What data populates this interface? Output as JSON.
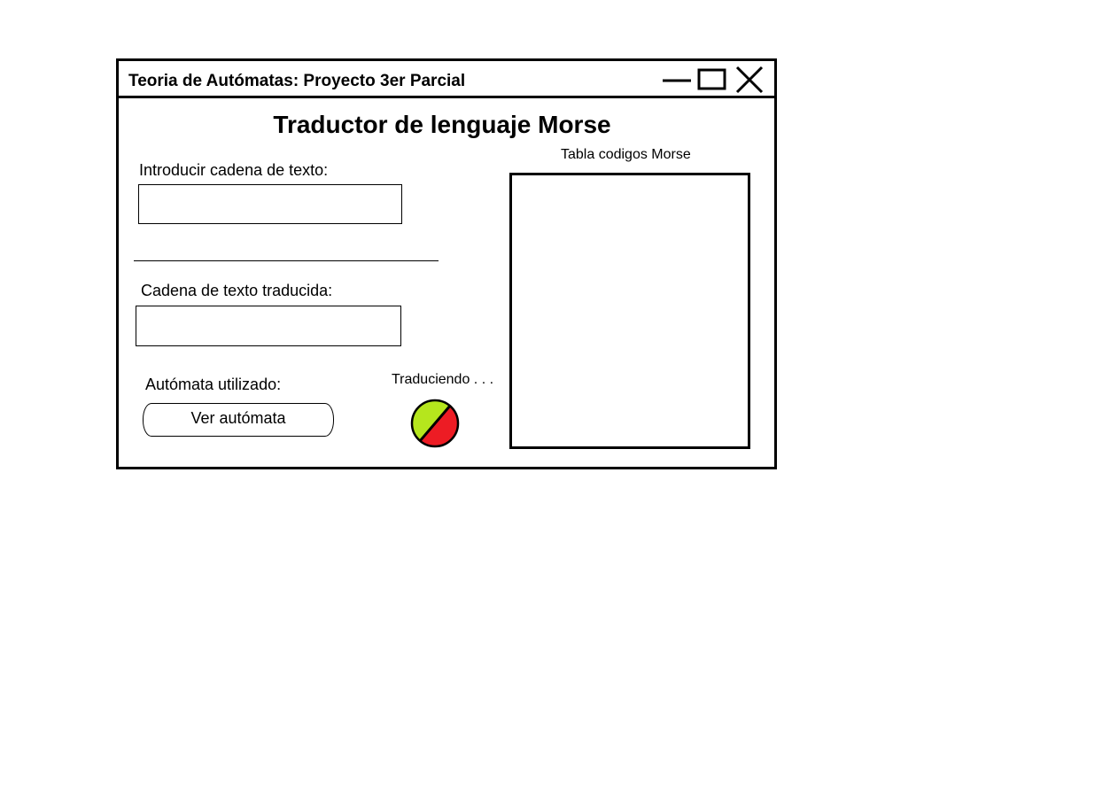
{
  "window": {
    "title": "Teoria de Autómatas: Proyecto 3er Parcial",
    "controls": [
      "minimize-icon",
      "maximize-icon",
      "close-icon"
    ]
  },
  "main": {
    "heading": "Traductor de lenguaje Morse",
    "input_label": "Introducir cadena de texto:",
    "input_value": "",
    "output_label": "Cadena de texto traducida:",
    "output_value": "",
    "automaton_label": "Autómata utilizado:",
    "view_automaton_button": "Ver autómata",
    "status_text": "Traduciendo . . .",
    "status_icon": "status-indicator-icon"
  },
  "morse_table": {
    "label": "Tabla codigos Morse"
  },
  "colors": {
    "status_green": "#b5e61d",
    "status_red": "#ed1c24"
  }
}
